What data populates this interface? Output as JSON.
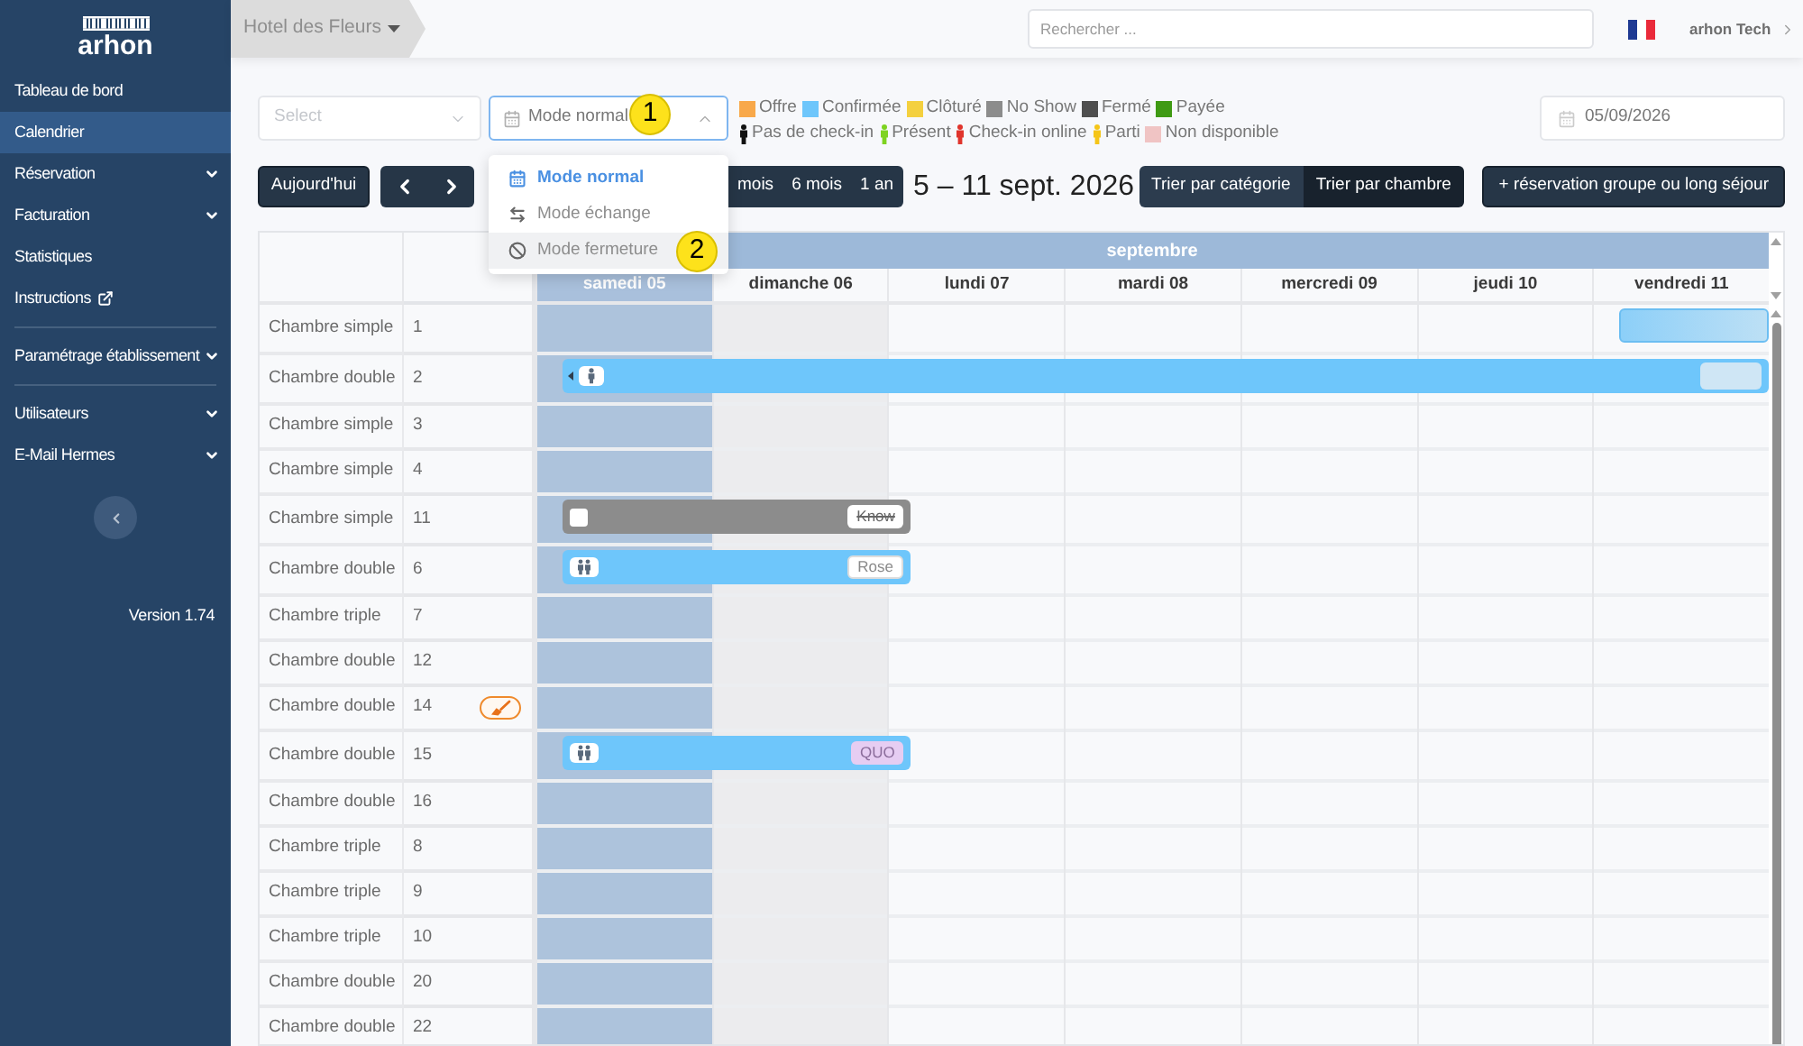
{
  "sidebar": {
    "logo_text": "arhon",
    "sections": [
      {
        "items": [
          {
            "label": "Tableau de bord",
            "kind": "link",
            "selected": false
          },
          {
            "label": "Calendrier",
            "kind": "link",
            "selected": true
          },
          {
            "label": "Réservation",
            "kind": "group",
            "selected": false
          },
          {
            "label": "Facturation",
            "kind": "group",
            "selected": false
          },
          {
            "label": "Statistiques",
            "kind": "link",
            "selected": false
          },
          {
            "label": "Instructions",
            "kind": "external",
            "selected": false
          }
        ]
      },
      {
        "items": [
          {
            "label": "Paramétrage établissement",
            "kind": "group",
            "selected": false
          }
        ]
      },
      {
        "items": [
          {
            "label": "Utilisateurs",
            "kind": "group",
            "selected": false
          },
          {
            "label": "E-Mail Hermes",
            "kind": "group",
            "selected": false
          }
        ]
      }
    ],
    "version": "Version 1.74"
  },
  "header": {
    "hotel": "Hotel des Fleurs",
    "search": {
      "placeholder": "Rechercher ..."
    },
    "user": "arhon Tech"
  },
  "filters": {
    "select": {
      "placeholder": "Select"
    },
    "mode": {
      "value": "Mode normal",
      "open": true,
      "marker": "1",
      "options": [
        {
          "label": "Mode normal",
          "kind": "normal",
          "selected": true,
          "hovered": false
        },
        {
          "label": "Mode échange",
          "kind": "exchange",
          "selected": false,
          "hovered": false
        },
        {
          "label": "Mode fermeture",
          "kind": "closure",
          "selected": false,
          "hovered": true,
          "marker": "2"
        }
      ]
    },
    "legend": [
      {
        "items": [
          {
            "label": "Offre",
            "kind": "square",
            "color": "#f8a84a"
          },
          {
            "label": "Confirmée",
            "kind": "square",
            "color": "#6ec6fb"
          },
          {
            "label": "Clôturé",
            "kind": "square",
            "color": "#f4d03f"
          },
          {
            "label": "No Show",
            "kind": "square",
            "color": "#8c8c8c"
          },
          {
            "label": "Fermé",
            "kind": "square",
            "color": "#4f4f4f"
          },
          {
            "label": "Payée",
            "kind": "square",
            "color": "#3f9a14"
          }
        ]
      },
      {
        "items": [
          {
            "label": "Pas de check-in",
            "kind": "person",
            "color": "#111111"
          },
          {
            "label": "Présent",
            "kind": "person",
            "color": "#7ed321"
          },
          {
            "label": "Check-in online",
            "kind": "person",
            "color": "#e0342c"
          },
          {
            "label": "Parti",
            "kind": "person",
            "color": "#f5c518"
          },
          {
            "label": "Non disponible",
            "kind": "square",
            "color": "#f0c4c4"
          }
        ]
      }
    ],
    "date": {
      "value": "05/09/2026"
    }
  },
  "toolbar": {
    "today": "Aujourd'hui",
    "periods": [
      {
        "label": "mois",
        "selected": false
      },
      {
        "label": "6 mois",
        "selected": false
      },
      {
        "label": "1 an",
        "selected": false
      }
    ],
    "range": "5 – 11 sept. 2026",
    "sort": [
      {
        "label": "Trier par catégorie",
        "selected": false
      },
      {
        "label": "Trier par chambre",
        "selected": true
      }
    ],
    "group_booking": "+ réservation groupe ou long séjour"
  },
  "calendar": {
    "month": "septembre",
    "days": [
      {
        "label": "samedi 05",
        "selected": true,
        "kind": "weekend"
      },
      {
        "label": "dimanche 06",
        "selected": false,
        "kind": "weekend"
      },
      {
        "label": "lundi 07",
        "selected": false,
        "kind": "weekday"
      },
      {
        "label": "mardi 08",
        "selected": false,
        "kind": "weekday"
      },
      {
        "label": "mercredi 09",
        "selected": false,
        "kind": "weekday"
      },
      {
        "label": "jeudi 10",
        "selected": false,
        "kind": "weekday"
      },
      {
        "label": "vendredi 11",
        "selected": false,
        "kind": "weekday"
      }
    ],
    "rows": [
      {
        "category": "Chambre simple",
        "room": "1",
        "cleaning": false,
        "booking": {
          "kind": "draft",
          "arrow": false,
          "nights": [
            false,
            false,
            false,
            false,
            false,
            false,
            true
          ]
        }
      },
      {
        "category": "Chambre double",
        "room": "2",
        "cleaning": false,
        "booking": {
          "kind": "confirmed",
          "arrow": true,
          "guests": {
            "kind": "single"
          },
          "tag": {
            "kind": "blank"
          },
          "nights": [
            true,
            true,
            true,
            true,
            true,
            true,
            true
          ]
        }
      },
      {
        "category": "Chambre simple",
        "room": "3",
        "cleaning": false
      },
      {
        "category": "Chambre simple",
        "room": "4",
        "cleaning": false
      },
      {
        "category": "Chambre simple",
        "room": "11",
        "cleaning": false,
        "booking": {
          "kind": "no_show",
          "arrow": false,
          "guests": {
            "kind": "square"
          },
          "tag": {
            "kind": "struck",
            "text": "Know"
          },
          "nights": [
            true,
            true,
            false,
            false,
            false,
            false,
            false
          ]
        }
      },
      {
        "category": "Chambre double",
        "room": "6",
        "cleaning": false,
        "booking": {
          "kind": "confirmed",
          "arrow": false,
          "guests": {
            "kind": "double"
          },
          "tag": {
            "kind": "plain",
            "text": "Rose"
          },
          "nights": [
            true,
            true,
            false,
            false,
            false,
            false,
            false
          ]
        }
      },
      {
        "category": "Chambre triple",
        "room": "7",
        "cleaning": false
      },
      {
        "category": "Chambre double",
        "room": "12",
        "cleaning": false
      },
      {
        "category": "Chambre double",
        "room": "14",
        "cleaning": true
      },
      {
        "category": "Chambre double",
        "room": "15",
        "cleaning": false,
        "booking": {
          "kind": "confirmed",
          "arrow": false,
          "guests": {
            "kind": "double"
          },
          "tag": {
            "kind": "highlight",
            "text": "QUO"
          },
          "nights": [
            true,
            true,
            false,
            false,
            false,
            false,
            false
          ]
        }
      },
      {
        "category": "Chambre double",
        "room": "16",
        "cleaning": false
      },
      {
        "category": "Chambre triple",
        "room": "8",
        "cleaning": false
      },
      {
        "category": "Chambre triple",
        "room": "9",
        "cleaning": false
      },
      {
        "category": "Chambre triple",
        "room": "10",
        "cleaning": false
      },
      {
        "category": "Chambre double",
        "room": "20",
        "cleaning": false
      },
      {
        "category": "Chambre double",
        "room": "22",
        "cleaning": false
      }
    ]
  }
}
